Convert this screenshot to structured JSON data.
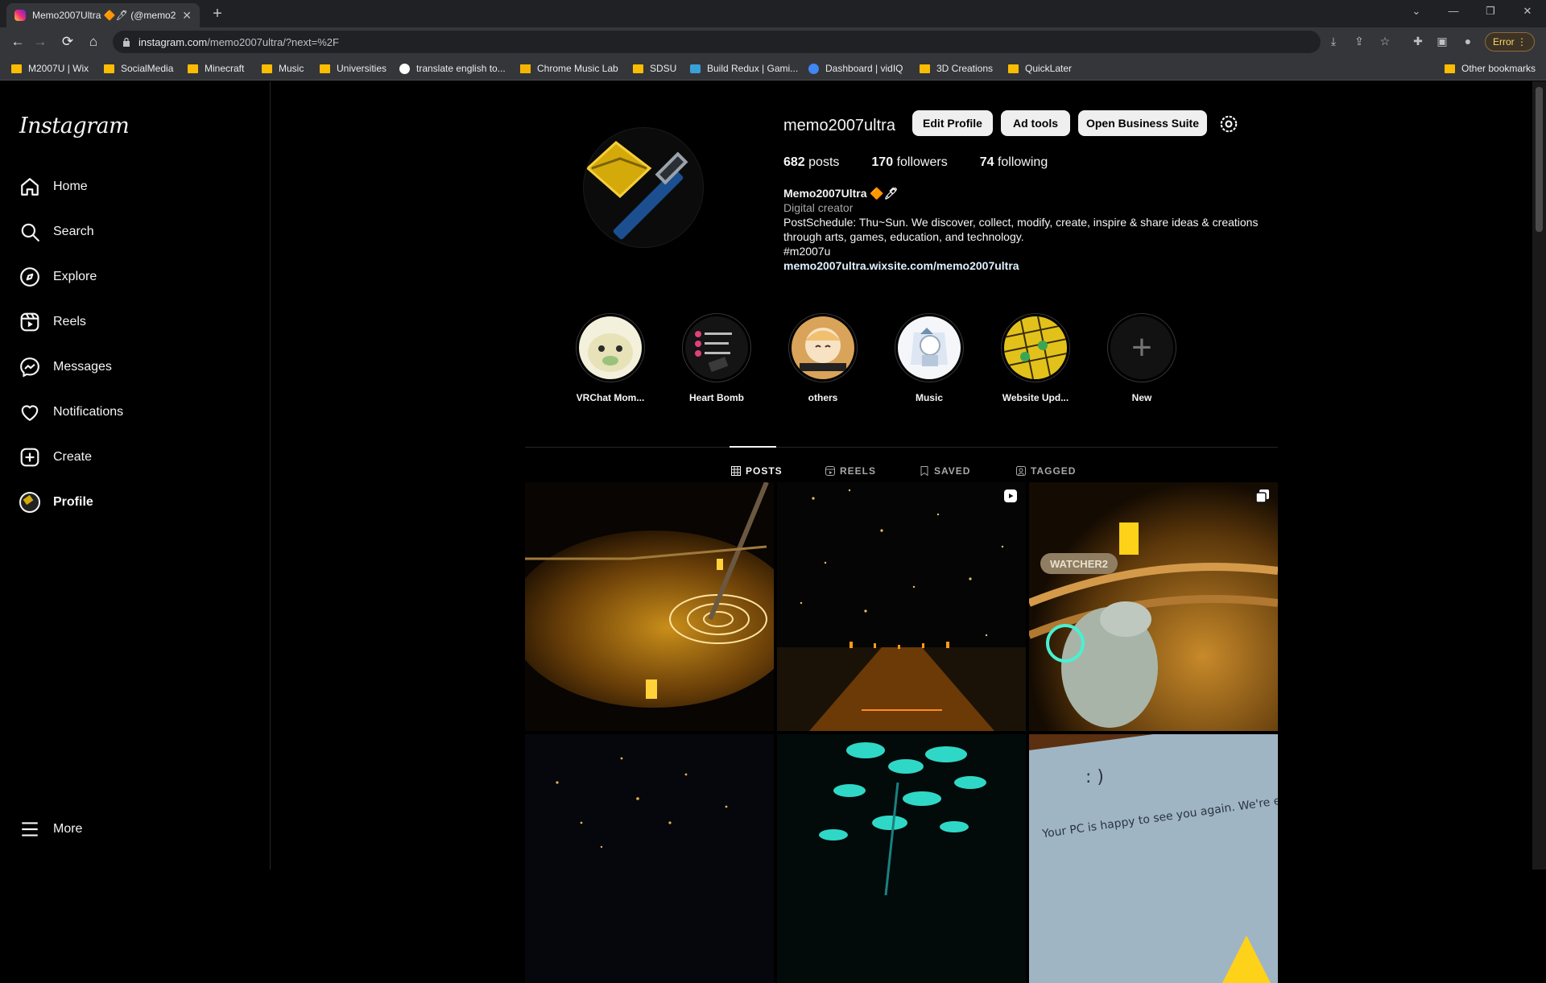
{
  "browser": {
    "tab_title": "Memo2007Ultra 🔶🖊 (@memo2007ultra)",
    "url_host": "instagram.com",
    "url_path": "/memo2007ultra/?next=%2F",
    "error_label": "Error",
    "bookmarks": [
      {
        "label": "M2007U | Wix",
        "icon": "folder"
      },
      {
        "label": "SocialMedia",
        "icon": "folder"
      },
      {
        "label": "Minecraft",
        "icon": "folder"
      },
      {
        "label": "Music",
        "icon": "folder"
      },
      {
        "label": "Universities",
        "icon": "folder"
      },
      {
        "label": "translate english to...",
        "icon": "google"
      },
      {
        "label": "Chrome Music Lab",
        "icon": "chrome-music-lab"
      },
      {
        "label": "SDSU",
        "icon": "folder"
      },
      {
        "label": "Build Redux | Gami...",
        "icon": "build-redux"
      },
      {
        "label": "Dashboard | vidIQ",
        "icon": "vidiq"
      },
      {
        "label": "3D Creations",
        "icon": "folder"
      },
      {
        "label": "QuickLater",
        "icon": "folder"
      }
    ],
    "other_bookmarks": "Other bookmarks"
  },
  "sidebar": {
    "logo": "Instagram",
    "items": [
      {
        "label": "Home",
        "icon": "home-icon"
      },
      {
        "label": "Search",
        "icon": "search-icon"
      },
      {
        "label": "Explore",
        "icon": "explore-icon"
      },
      {
        "label": "Reels",
        "icon": "reels-icon"
      },
      {
        "label": "Messages",
        "icon": "messages-icon"
      },
      {
        "label": "Notifications",
        "icon": "heart-icon"
      },
      {
        "label": "Create",
        "icon": "create-icon"
      },
      {
        "label": "Profile",
        "icon": "avatar"
      }
    ],
    "more": "More"
  },
  "profile": {
    "username": "memo2007ultra",
    "buttons": {
      "edit": "Edit Profile",
      "ad_tools": "Ad tools",
      "business": "Open Business Suite"
    },
    "stats": {
      "posts_count": "682",
      "posts_label": "posts",
      "followers_count": "170",
      "followers_label": "followers",
      "following_count": "74",
      "following_label": "following"
    },
    "bio": {
      "name": "Memo2007Ultra 🔶🖊",
      "category": "Digital creator",
      "text": "PostSchedule: Thu~Sun. We discover, collect, modify, create, inspire & share ideas & creations through arts, games, education, and technology.",
      "hashtag": "#m2007u",
      "link": "memo2007ultra.wixsite.com/memo2007ultra"
    }
  },
  "highlights": [
    {
      "label": "VRChat Mom..."
    },
    {
      "label": "Heart Bomb"
    },
    {
      "label": "others"
    },
    {
      "label": "Music"
    },
    {
      "label": "Website Upd..."
    },
    {
      "label": "New"
    }
  ],
  "tabs": {
    "posts": "POSTS",
    "reels": "REELS",
    "saved": "SAVED",
    "tagged": "TAGGED"
  },
  "posts": [
    {
      "type": "photo"
    },
    {
      "type": "reel"
    },
    {
      "type": "carousel",
      "overlay_text": "WATCHER2"
    },
    {
      "type": "photo"
    },
    {
      "type": "photo"
    },
    {
      "type": "photo",
      "overlay_text": "Your PC is happy to see you again. We're excited, what will you create and share with us? press the spacebar."
    }
  ]
}
